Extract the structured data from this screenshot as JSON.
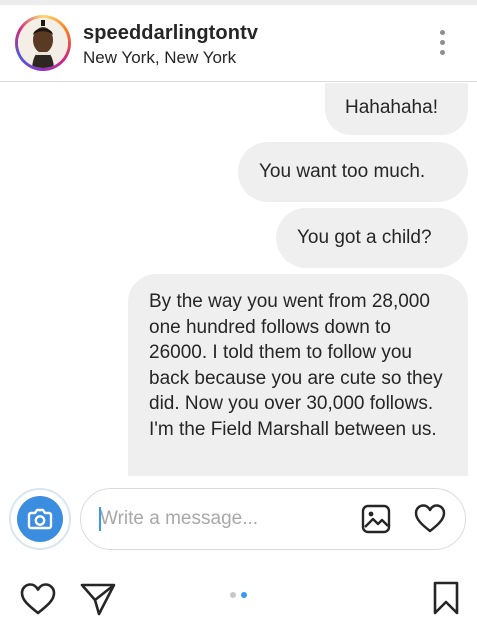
{
  "header": {
    "username": "speeddarlingtontv",
    "location": "New York, New York"
  },
  "messages": [
    {
      "text": "Hahahaha!"
    },
    {
      "text": "You want too much."
    },
    {
      "text": "You got a child?"
    },
    {
      "text": "By the way you went from 28,000 one hundred follows down to 26000. I told them to follow you back because you are cute so they did. Now you over 30,000 follows. I'm the Field Marshall between us."
    }
  ],
  "composer": {
    "placeholder": "Write a message..."
  },
  "colors": {
    "bubble": "#efefef",
    "camera": "#3b8de0",
    "page_indicator_active": "#3897f0",
    "page_indicator_inactive": "#c7c7c7"
  },
  "icons": [
    "more-vertical-icon",
    "camera-icon",
    "image-icon",
    "heart-icon",
    "share-icon",
    "bookmark-icon"
  ]
}
